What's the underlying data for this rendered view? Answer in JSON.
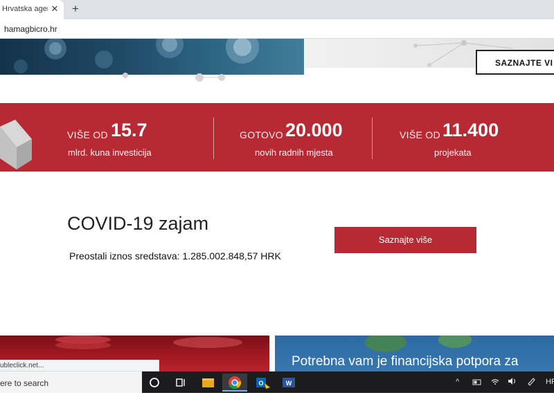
{
  "browser": {
    "tab_title": "Hrvatska agencija",
    "tab_close": "✕",
    "new_tab": "+",
    "address": "hamagbicro.hr"
  },
  "hero": {
    "button_label": "SAZNAJTE VI"
  },
  "stats": [
    {
      "prefix": "VIŠE OD",
      "value": "15.7",
      "caption": "mlrd. kuna investicija"
    },
    {
      "prefix": "GOTOVO",
      "value": "20.000",
      "caption": "novih radnih mjesta"
    },
    {
      "prefix": "VIŠE OD",
      "value": "11.400",
      "caption": "projekata"
    }
  ],
  "covid": {
    "title": "COVID-19 zajam",
    "remaining": "Preostali iznos sredstava: 1.285.002.848,57 HRK",
    "button_label": "Saznajte više"
  },
  "cards": {
    "right_title": "Potrebna vam je financijska potpora za"
  },
  "status_bar": {
    "url": "ubleclick.net..."
  },
  "taskbar": {
    "search_placeholder": "ere to search",
    "language": "HR"
  },
  "colors": {
    "brand_red": "#b82a33",
    "card_blue": "#3a78b0"
  }
}
